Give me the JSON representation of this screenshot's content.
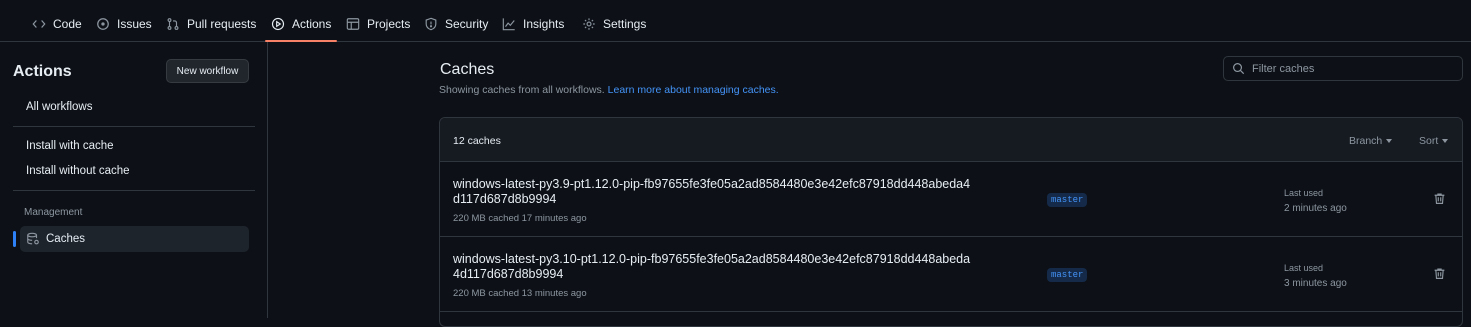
{
  "nav": {
    "tabs": [
      {
        "label": "Code",
        "icon": "code-icon"
      },
      {
        "label": "Issues",
        "icon": "issue-icon"
      },
      {
        "label": "Pull requests",
        "icon": "pull-request-icon"
      },
      {
        "label": "Actions",
        "icon": "play-icon",
        "active": true
      },
      {
        "label": "Projects",
        "icon": "table-icon"
      },
      {
        "label": "Security",
        "icon": "shield-icon"
      },
      {
        "label": "Insights",
        "icon": "graph-icon"
      },
      {
        "label": "Settings",
        "icon": "gear-icon"
      }
    ]
  },
  "sidebar": {
    "title": "Actions",
    "new_workflow": "New workflow",
    "all_workflows": "All workflows",
    "workflows": [
      "Install with cache",
      "Install without cache"
    ],
    "section": "Management",
    "active_item": "Caches"
  },
  "main": {
    "title": "Caches",
    "subtitle": "Showing caches from all workflows.",
    "learn_more": "Learn more about managing caches.",
    "filter_placeholder": "Filter caches",
    "count": "12 caches",
    "branch_menu": "Branch",
    "sort_menu": "Sort",
    "last_used_label": "Last used",
    "rows": [
      {
        "name": "windows-latest-py3.9-pt1.12.0-pip-fb97655fe3fe05a2ad8584480e3e42efc87918dd448abeda4d117d687d8b9994",
        "meta": "220 MB cached 17 minutes ago",
        "branch": "master",
        "last_used": "2 minutes ago"
      },
      {
        "name": "windows-latest-py3.10-pt1.12.0-pip-fb97655fe3fe05a2ad8584480e3e42efc87918dd448abeda4d117d687d8b9994",
        "meta": "220 MB cached 13 minutes ago",
        "branch": "master",
        "last_used": "3 minutes ago"
      }
    ]
  },
  "colors": {
    "background": "#0d1117",
    "border": "#30363d",
    "accent_tab": "#f78166",
    "link": "#4493f8",
    "muted": "#8d96a0"
  }
}
